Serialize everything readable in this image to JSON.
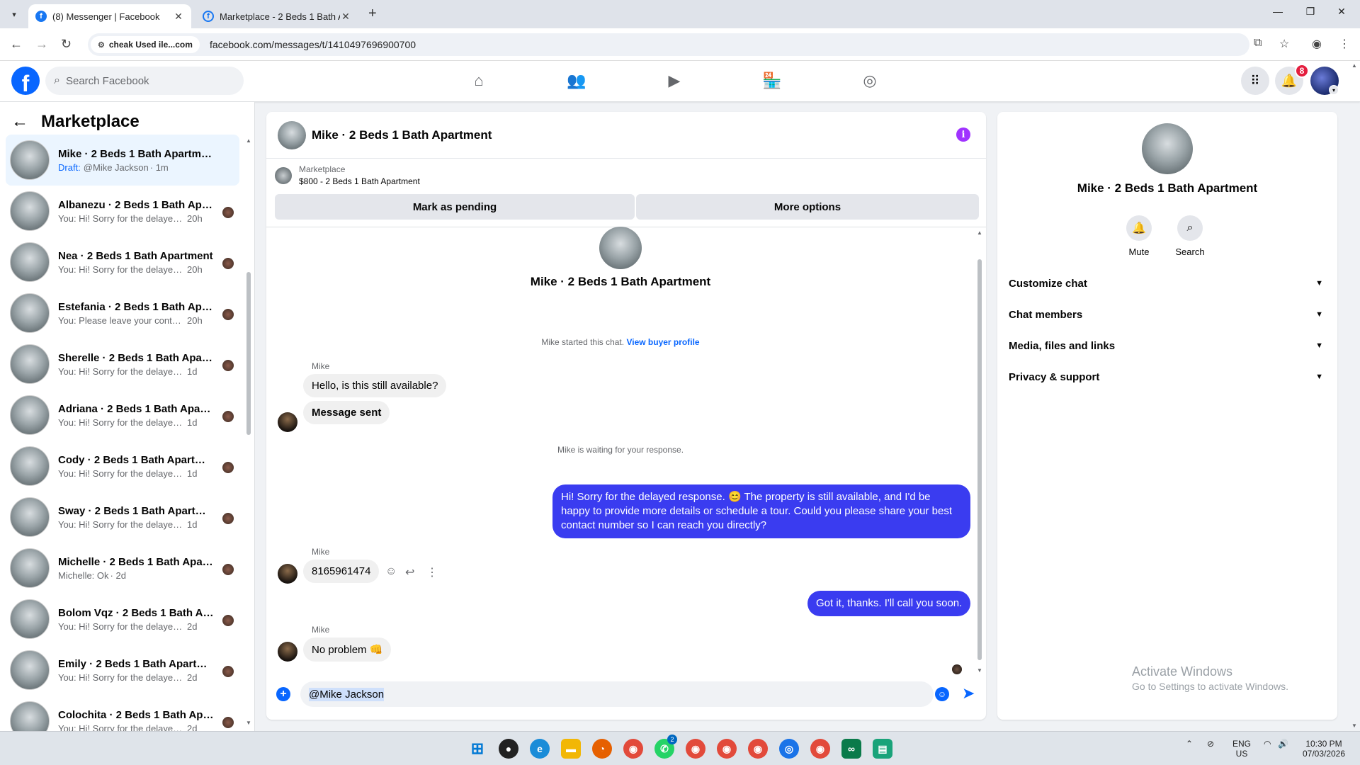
{
  "browser": {
    "tabs": [
      {
        "title": "(8) Messenger | Facebook",
        "active": true
      },
      {
        "title": "Marketplace - 2 Beds 1 Bath Ap",
        "active": false
      }
    ],
    "site_chip": "cheak Used ile...com",
    "url": "facebook.com/messages/t/1410497696900700"
  },
  "fb_header": {
    "search_placeholder": "Search Facebook",
    "notification_count": "8",
    "nav_icons": [
      "home-icon",
      "friends-icon",
      "video-icon",
      "marketplace-icon",
      "groups-icon"
    ]
  },
  "left_panel": {
    "title": "Marketplace",
    "conversations": [
      {
        "name": "Mike · 2 Beds 1 Bath Apartment",
        "draft": "Draft:",
        "snippet": "@Mike Jackson",
        "time": "· 1m",
        "active": true
      },
      {
        "name": "Albanezu · 2 Beds 1 Bath Apar...",
        "draft": "",
        "snippet": "You: Hi! Sorry for the delayed r...",
        "time": "20h"
      },
      {
        "name": "Nea · 2 Beds 1 Bath Apartment",
        "draft": "",
        "snippet": "You: Hi! Sorry for the delayed r...",
        "time": "20h"
      },
      {
        "name": "Estefania · 2 Beds 1 Bath Apar...",
        "draft": "",
        "snippet": "You: Please leave your contact ...",
        "time": "20h"
      },
      {
        "name": "Sherelle · 2 Beds 1 Bath Apart...",
        "draft": "",
        "snippet": "You: Hi! Sorry for the delayed res...",
        "time": "1d"
      },
      {
        "name": "Adriana · 2 Beds 1 Bath Apart...",
        "draft": "",
        "snippet": "You: Hi! Sorry for the delayed res...",
        "time": "1d"
      },
      {
        "name": "Cody · 2 Beds 1 Bath Apartment",
        "draft": "",
        "snippet": "You: Hi! Sorry for the delayed res...",
        "time": "1d"
      },
      {
        "name": "Sway · 2 Beds 1 Bath Apartment",
        "draft": "",
        "snippet": "You: Hi! Sorry for the delayed res...",
        "time": "1d"
      },
      {
        "name": "Michelle · 2 Beds 1 Bath Apartm...",
        "draft": "",
        "snippet": "Michelle: Ok",
        "time": "· 2d"
      },
      {
        "name": "Bolom Vqz · 2 Beds 1 Bath Ap...",
        "draft": "",
        "snippet": "You: Hi! Sorry for the delayed res...",
        "time": "2d"
      },
      {
        "name": "Emily · 2 Beds 1 Bath Apartment",
        "draft": "",
        "snippet": "You: Hi! Sorry for the delayed res...",
        "time": "2d"
      },
      {
        "name": "Colochita · 2 Beds 1 Bath Apar...",
        "draft": "",
        "snippet": "You: Hi! Sorry for the delayed res...",
        "time": "2d"
      }
    ]
  },
  "chat": {
    "title": "Mike · 2 Beds 1 Bath Apartment",
    "listing_source": "Marketplace",
    "listing_title": "$800 - 2 Beds 1 Bath Apartment",
    "mark_pending": "Mark as pending",
    "more_options": "More options",
    "hero_name": "Mike · 2 Beds 1 Bath Apartment",
    "started_text": "Mike started this chat.",
    "view_profile": "View buyer profile",
    "sender_name": "Mike",
    "msg1": "Hello, is this still available?",
    "msg2": "Message sent",
    "waiting_text": "Mike is waiting for your response.",
    "out1": "Hi! Sorry for the delayed response. 😊 The property is still available, and I'd be happy to provide more details or schedule a tour. Could you please share your best contact number so I can reach you directly?",
    "msg3": "8165961474",
    "out2": "Got it, thanks. I'll call you soon.",
    "msg4": "No problem 👊",
    "composer_value": "@Mike Jackson"
  },
  "right_panel": {
    "name": "Mike · 2 Beds 1 Bath Apartment",
    "mute": "Mute",
    "search": "Search",
    "sections": [
      "Customize chat",
      "Chat members",
      "Media, files and links",
      "Privacy & support"
    ],
    "activate_title": "Activate Windows",
    "activate_sub": "Go to Settings to activate Windows."
  },
  "taskbar": {
    "lang1": "ENG",
    "lang2": "US",
    "time": "10:30 PM",
    "date": "07/03/2026",
    "whatsapp_badge": "2"
  }
}
